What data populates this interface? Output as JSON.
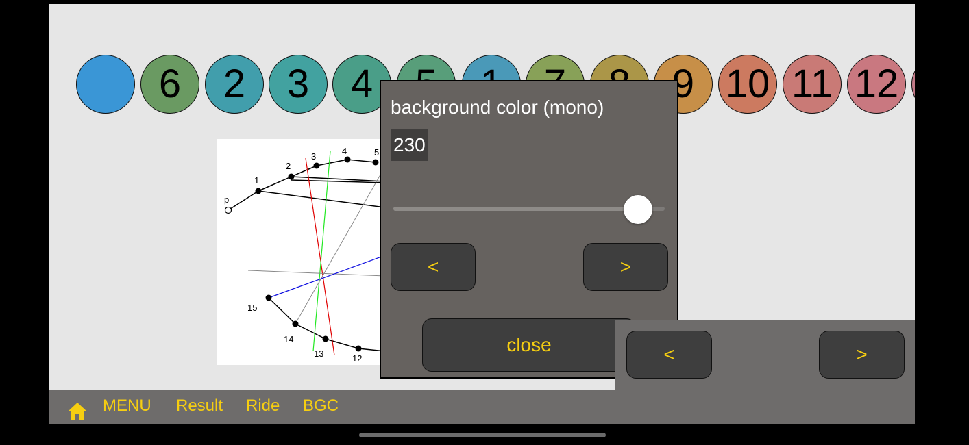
{
  "circles": [
    {
      "label": "",
      "color": "#3a96d6"
    },
    {
      "label": "6",
      "color": "#6a9a62"
    },
    {
      "label": "2",
      "color": "#419eac"
    },
    {
      "label": "3",
      "color": "#42a2a0"
    },
    {
      "label": "4",
      "color": "#4a9e88"
    },
    {
      "label": "5",
      "color": "#589e7a"
    },
    {
      "label": "1",
      "color": "#4a99b8"
    },
    {
      "label": "7",
      "color": "#88a158"
    },
    {
      "label": "8",
      "color": "#ab9648"
    },
    {
      "label": "9",
      "color": "#c78f48"
    },
    {
      "label": "10",
      "color": "#cc7a60"
    },
    {
      "label": "11",
      "color": "#c97a76"
    },
    {
      "label": "12",
      "color": "#c97880"
    },
    {
      "label": "",
      "color": "#c27a88"
    }
  ],
  "diagram": {
    "start_label": "p",
    "point_labels": [
      "1",
      "2",
      "3",
      "4",
      "5",
      "12",
      "13",
      "14",
      "15"
    ]
  },
  "dialog": {
    "title": "background color (mono)",
    "value": "230",
    "slider_fraction": 0.902,
    "prev_label": "<",
    "next_label": ">",
    "close_label": "close"
  },
  "panel2": {
    "prev_label": "<",
    "next_label": ">"
  },
  "bottombar": {
    "items": [
      "MENU",
      "Result",
      "Ride",
      "BGC"
    ]
  },
  "colors": {
    "accent": "#f6ce11",
    "background": "#e6e6e6"
  }
}
